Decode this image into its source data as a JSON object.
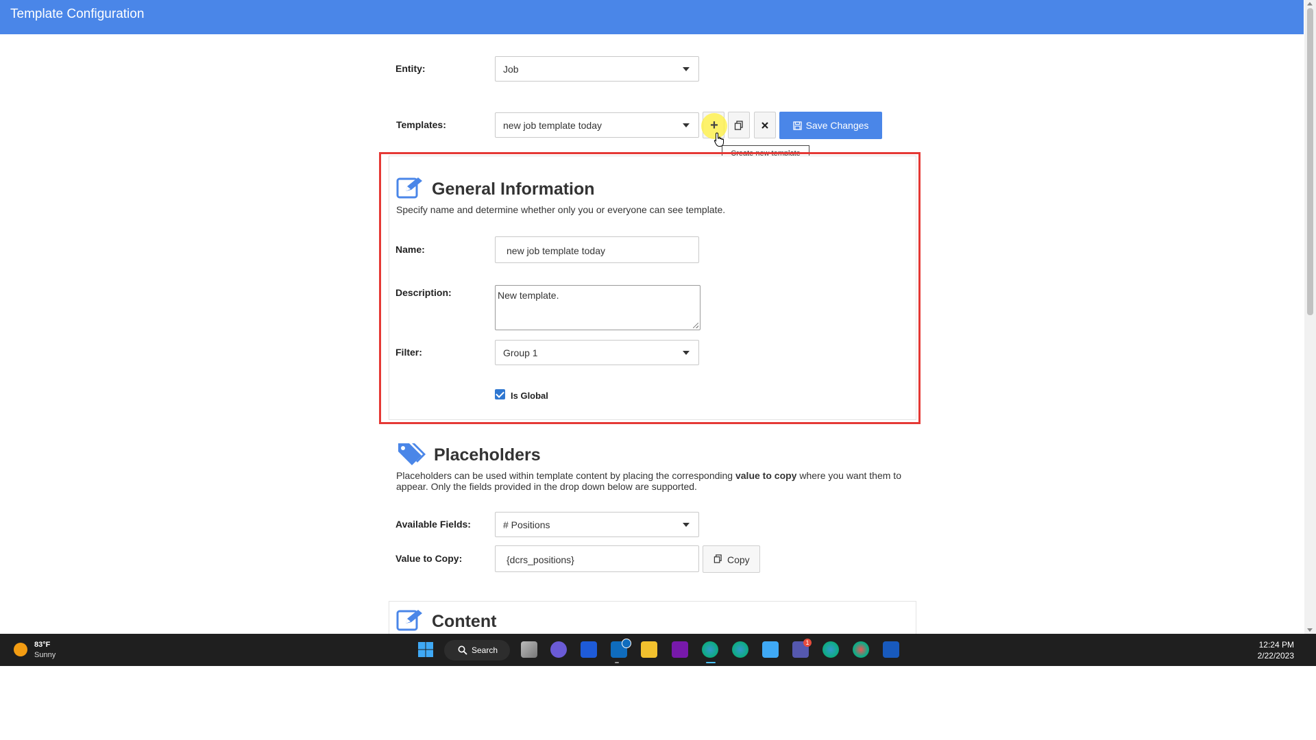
{
  "header": {
    "title": "Template Configuration"
  },
  "form": {
    "entity_label": "Entity:",
    "entity_value": "Job",
    "templates_label": "Templates:",
    "templates_value": "new job template today",
    "save_label": "Save Changes",
    "tooltip": "Create new template"
  },
  "general": {
    "title": "General Information",
    "desc": "Specify name and determine whether only you or everyone can see template.",
    "name_label": "Name:",
    "name_value": "new job template today",
    "description_label": "Description:",
    "description_value": "New template.",
    "filter_label": "Filter:",
    "filter_value": "Group 1",
    "is_global_label": "Is Global",
    "is_global_checked": true
  },
  "placeholders": {
    "title": "Placeholders",
    "desc_part1": "Placeholders can be used within template content by placing the corresponding ",
    "desc_bold": "value to copy",
    "desc_part2": " where you want them to appear. Only the fields provided in the drop down below are supported.",
    "fields_label": "Available Fields:",
    "fields_value": "# Positions",
    "value_label": "Value to Copy:",
    "value_value": "{dcrs_positions}",
    "copy_label": "Copy"
  },
  "content": {
    "title": "Content"
  },
  "taskbar": {
    "weather_temp": "83°F",
    "weather_cond": "Sunny",
    "search_label": "Search",
    "time": "12:24 PM",
    "date": "2/22/2023",
    "outlook_badge": "",
    "teams_badge": "1"
  },
  "colors": {
    "header": "#4a86e8",
    "accent": "#4a86e8",
    "highlight": "#e53935"
  }
}
